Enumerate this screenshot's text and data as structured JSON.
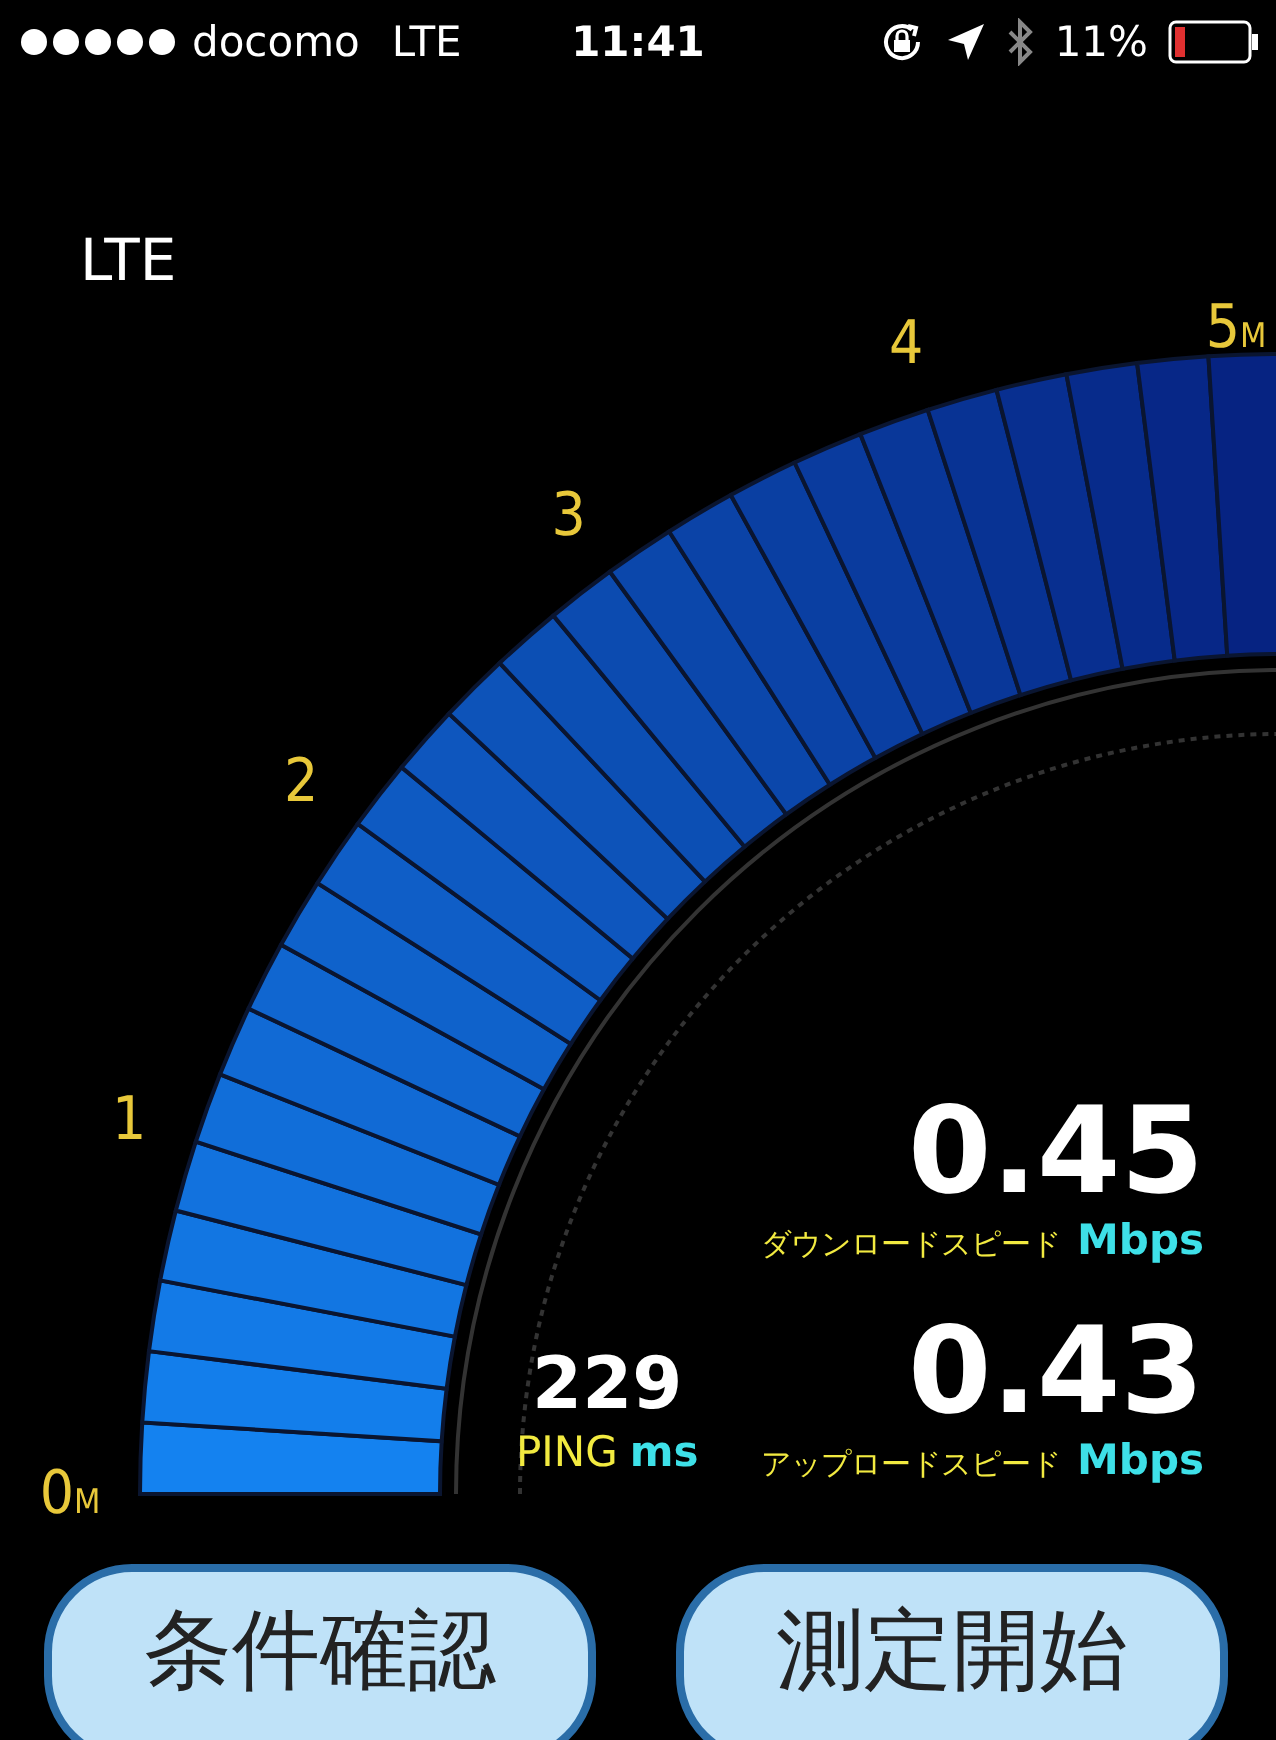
{
  "status_bar": {
    "carrier": "docomo",
    "network": "LTE",
    "time": "11:41",
    "battery_percent": "11%"
  },
  "connection_type": "LTE",
  "gauge": {
    "ticks": [
      {
        "number": "0",
        "unit": "M"
      },
      {
        "number": "1"
      },
      {
        "number": "2"
      },
      {
        "number": "3"
      },
      {
        "number": "4"
      },
      {
        "number": "5",
        "unit": "M"
      }
    ]
  },
  "readings": {
    "download": {
      "value": "0.45",
      "label": "ダウンロードスピード",
      "unit": "Mbps"
    },
    "upload": {
      "value": "0.43",
      "label": "アップロードスピード",
      "unit": "Mbps"
    },
    "ping": {
      "value": "229",
      "label": "PING",
      "unit": "ms"
    }
  },
  "buttons": [
    {
      "label": "条件確認"
    },
    {
      "label": "測定開始"
    }
  ]
}
